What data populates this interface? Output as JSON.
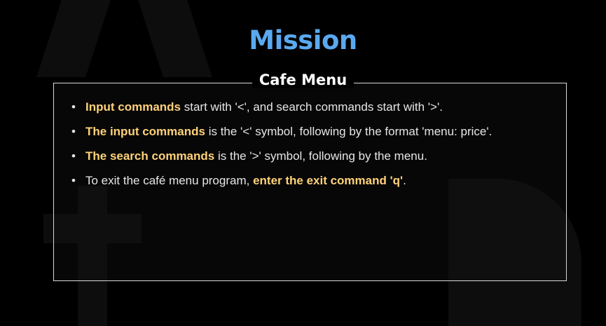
{
  "title": "Mission",
  "section_label": "Cafe Menu",
  "bullets": [
    {
      "strong": "Input commands",
      "rest": " start with '<', and search commands start with '>'."
    },
    {
      "strong": "The input commands",
      "rest": " is the '<' symbol, following by the format 'menu: price'."
    },
    {
      "strong": "The search commands",
      "rest": " is the '>' symbol, following by the menu."
    },
    {
      "pre": "To exit the café menu program, ",
      "strong": "enter the exit command 'q'",
      "post": "."
    }
  ],
  "colors": {
    "title": "#5aa9f0",
    "highlight": "#ffd27a",
    "background": "#000000",
    "frame": "#d9d9d9"
  }
}
